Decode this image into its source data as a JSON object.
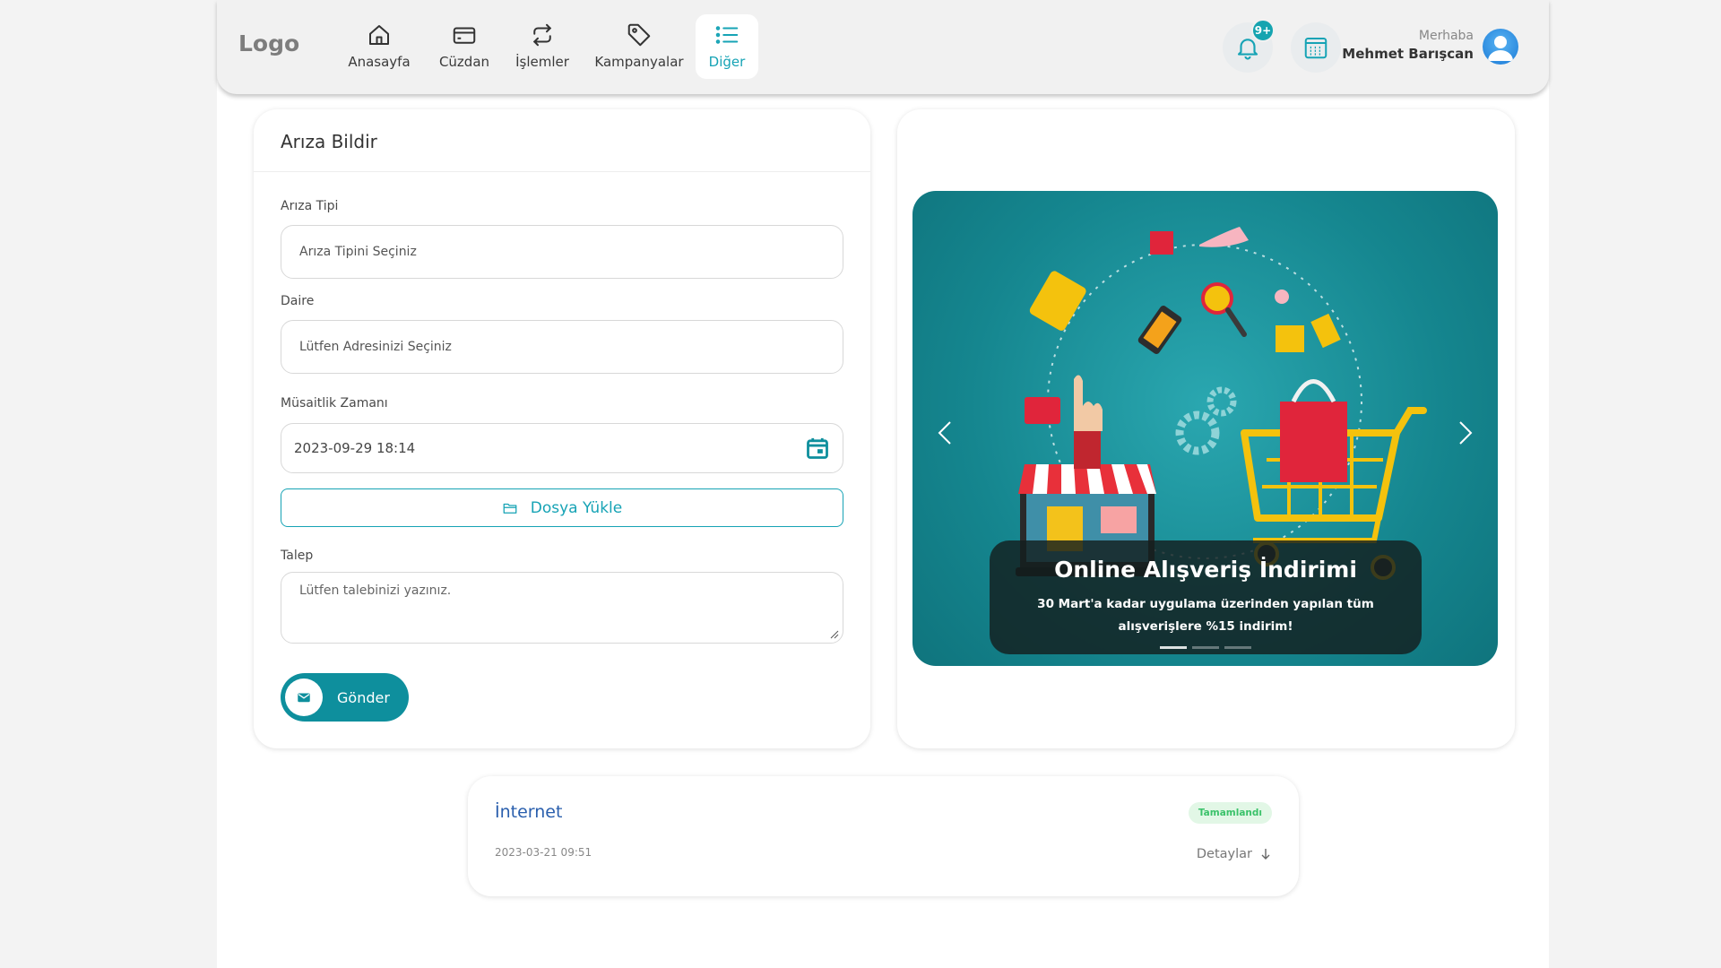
{
  "header": {
    "logo": "Logo",
    "nav": [
      {
        "label": "Anasayfa",
        "icon": "home-icon"
      },
      {
        "label": "Cüzdan",
        "icon": "wallet-icon"
      },
      {
        "label": "İşlemler",
        "icon": "repeat-icon"
      },
      {
        "label": "Kampanyalar",
        "icon": "tag-icon"
      },
      {
        "label": "Diğer",
        "icon": "list-icon",
        "active": true
      }
    ],
    "notification_badge": "9+",
    "greeting": "Merhaba",
    "user_name": "Mehmet Barışcan"
  },
  "form": {
    "title": "Arıza Bildir",
    "fault_type_label": "Arıza Tipi",
    "fault_type_value": "Arıza Tipini Seçiniz",
    "apartment_label": "Daire",
    "apartment_value": "Lütfen Adresinizi Seçiniz",
    "availability_label": "Müsaitlik Zamanı",
    "availability_value": "2023-09-29 18:14",
    "upload_label": "Dosya Yükle",
    "request_label": "Talep",
    "request_placeholder": "Lütfen talebinizi yazınız.",
    "submit_label": "Gönder"
  },
  "banner": {
    "title": "Online Alışveriş İndirimi",
    "text": "30 Mart'a kadar uygulama üzerinden yapılan tüm alışverişlere %15 indirim!",
    "slides": 3,
    "active_slide": 1
  },
  "requests": [
    {
      "title": "İnternet",
      "date": "2023-03-21 09:51",
      "status": "Tamamlandı",
      "details_label": "Detaylar"
    }
  ],
  "colors": {
    "accent": "#16a3b5",
    "button": "#0e8f9d",
    "status_done": "#3bc26a"
  }
}
